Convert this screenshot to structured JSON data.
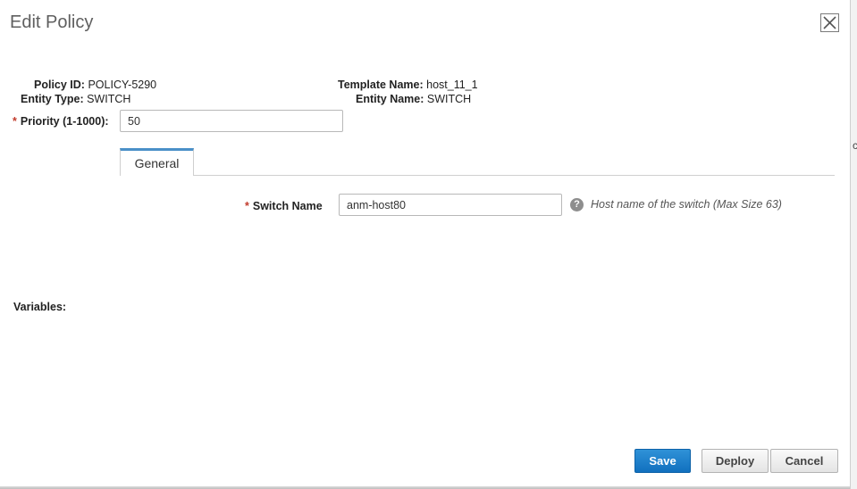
{
  "dialog": {
    "title": "Edit Policy"
  },
  "policy": {
    "policy_id_label": "Policy ID:",
    "policy_id_value": "POLICY-5290",
    "entity_type_label": "Entity Type:",
    "entity_type_value": "SWITCH",
    "template_name_label": "Template Name:",
    "template_name_value": "host_11_1",
    "entity_name_label": "Entity Name:",
    "entity_name_value": "SWITCH"
  },
  "priority": {
    "required_marker": "*",
    "label": "Priority (1-1000):",
    "value": "50"
  },
  "tabs": [
    {
      "label": "General",
      "active": true
    }
  ],
  "switch_name": {
    "required_marker": "*",
    "label": "Switch Name",
    "value": "anm-host80",
    "help_icon": "?",
    "help_text": "Host name of the switch (Max Size 63)"
  },
  "variables": {
    "label": "Variables:"
  },
  "buttons": {
    "save": "Save",
    "deploy": "Deploy",
    "cancel": "Cancel"
  },
  "background_fragments": {
    "frag1": "c"
  },
  "colors": {
    "accent": "#1170bf",
    "required": "#c23b2c",
    "tab_active": "#4a90c8"
  }
}
